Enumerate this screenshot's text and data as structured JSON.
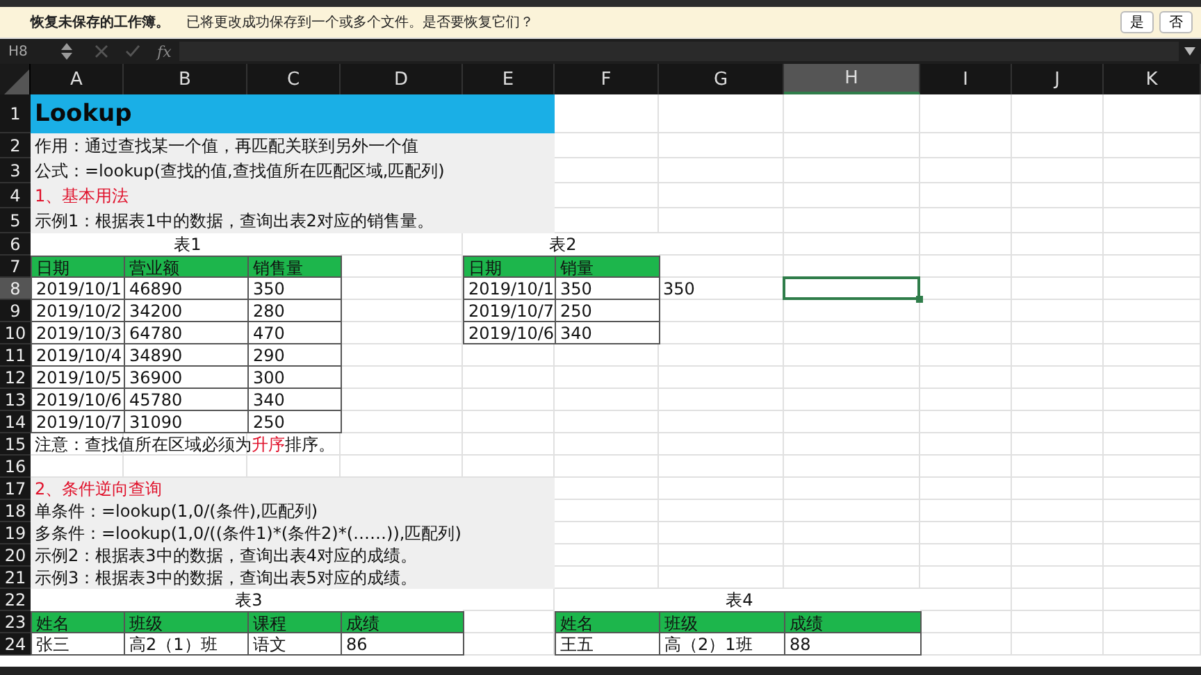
{
  "notification": {
    "title": "恢复未保存的工作簿。",
    "message": "已将更改成功保存到一个或多个文件。是否要恢复它们？",
    "buttons": [
      "是",
      "否"
    ]
  },
  "formula_bar": {
    "name_box": "H8",
    "fx": "fx"
  },
  "columns": [
    {
      "label": "A",
      "selected": false
    },
    {
      "label": "B",
      "selected": false
    },
    {
      "label": "C",
      "selected": false
    },
    {
      "label": "D",
      "selected": false
    },
    {
      "label": "E",
      "selected": false
    },
    {
      "label": "F",
      "selected": false
    },
    {
      "label": "G",
      "selected": false
    },
    {
      "label": "H",
      "selected": true
    },
    {
      "label": "I",
      "selected": false
    },
    {
      "label": "J",
      "selected": false
    },
    {
      "label": "K",
      "selected": false
    }
  ],
  "row_headers": [
    {
      "label": "1",
      "selected": false
    },
    {
      "label": "2",
      "selected": false
    },
    {
      "label": "3",
      "selected": false
    },
    {
      "label": "4",
      "selected": false
    },
    {
      "label": "5",
      "selected": false
    },
    {
      "label": "6",
      "selected": false
    },
    {
      "label": "7",
      "selected": false
    },
    {
      "label": "8",
      "selected": true
    },
    {
      "label": "9",
      "selected": false
    },
    {
      "label": "10",
      "selected": false
    },
    {
      "label": "11",
      "selected": false
    },
    {
      "label": "12",
      "selected": false
    },
    {
      "label": "13",
      "selected": false
    },
    {
      "label": "14",
      "selected": false
    },
    {
      "label": "15",
      "selected": false
    },
    {
      "label": "16",
      "selected": false
    },
    {
      "label": "17",
      "selected": false
    },
    {
      "label": "18",
      "selected": false
    },
    {
      "label": "19",
      "selected": false
    },
    {
      "label": "20",
      "selected": false
    },
    {
      "label": "21",
      "selected": false
    },
    {
      "label": "22",
      "selected": false
    },
    {
      "label": "23",
      "selected": false
    },
    {
      "label": "24",
      "selected": false
    }
  ],
  "title": "Lookup",
  "intro": [
    {
      "kind": "note",
      "text": "作用：通过查找某一个值，再匹配关联到另外一个值"
    },
    {
      "kind": "note",
      "text": "公式：=lookup(查找的值,查找值所在匹配区域,匹配列)"
    },
    {
      "kind": "heading",
      "text": "1、基本用法"
    },
    {
      "kind": "note",
      "text": "示例1：根据表1中的数据，查询出表2对应的销售量。"
    }
  ],
  "table1": {
    "caption": "表1",
    "columns": [
      "日期",
      "营业额",
      "销售量"
    ],
    "rows": [
      [
        "2019/10/1",
        "46890",
        "350"
      ],
      [
        "2019/10/2",
        "34200",
        "280"
      ],
      [
        "2019/10/3",
        "64780",
        "470"
      ],
      [
        "2019/10/4",
        "34890",
        "290"
      ],
      [
        "2019/10/5",
        "36900",
        "300"
      ],
      [
        "2019/10/6",
        "45780",
        "340"
      ],
      [
        "2019/10/7",
        "31090",
        "250"
      ]
    ]
  },
  "table2": {
    "caption": "表2",
    "columns": [
      "日期",
      "销量"
    ],
    "rows": [
      [
        "2019/10/1",
        "350"
      ],
      [
        "2019/10/7",
        "250"
      ],
      [
        "2019/10/6",
        "340"
      ]
    ]
  },
  "result": "350",
  "notice": {
    "parts": [
      {
        "text": "注意：查找值所在区域必须为",
        "highlight": false
      },
      {
        "text": "升序",
        "highlight": true
      },
      {
        "text": "排序。",
        "highlight": false
      }
    ]
  },
  "section2": [
    {
      "kind": "heading",
      "text": "2、条件逆向查询"
    },
    {
      "kind": "note",
      "text": "单条件：=lookup(1,0/(条件),匹配列)"
    },
    {
      "kind": "note",
      "text": "多条件：=lookup(1,0/((条件1)*(条件2)*(……)),匹配列)"
    },
    {
      "kind": "note",
      "text": "示例2：根据表3中的数据，查询出表4对应的成绩。"
    },
    {
      "kind": "note",
      "text": "示例3：根据表3中的数据，查询出表5对应的成绩。"
    }
  ],
  "table3": {
    "caption": "表3",
    "columns": [
      "姓名",
      "班级",
      "课程",
      "成绩"
    ],
    "rows": [
      [
        "张三",
        "高2（1）班",
        "语文",
        "86"
      ]
    ]
  },
  "table4": {
    "caption": "表4",
    "columns": [
      "姓名",
      "班级",
      "成绩"
    ],
    "rows": [
      [
        "王五",
        "高（2）1班",
        "88"
      ]
    ]
  }
}
